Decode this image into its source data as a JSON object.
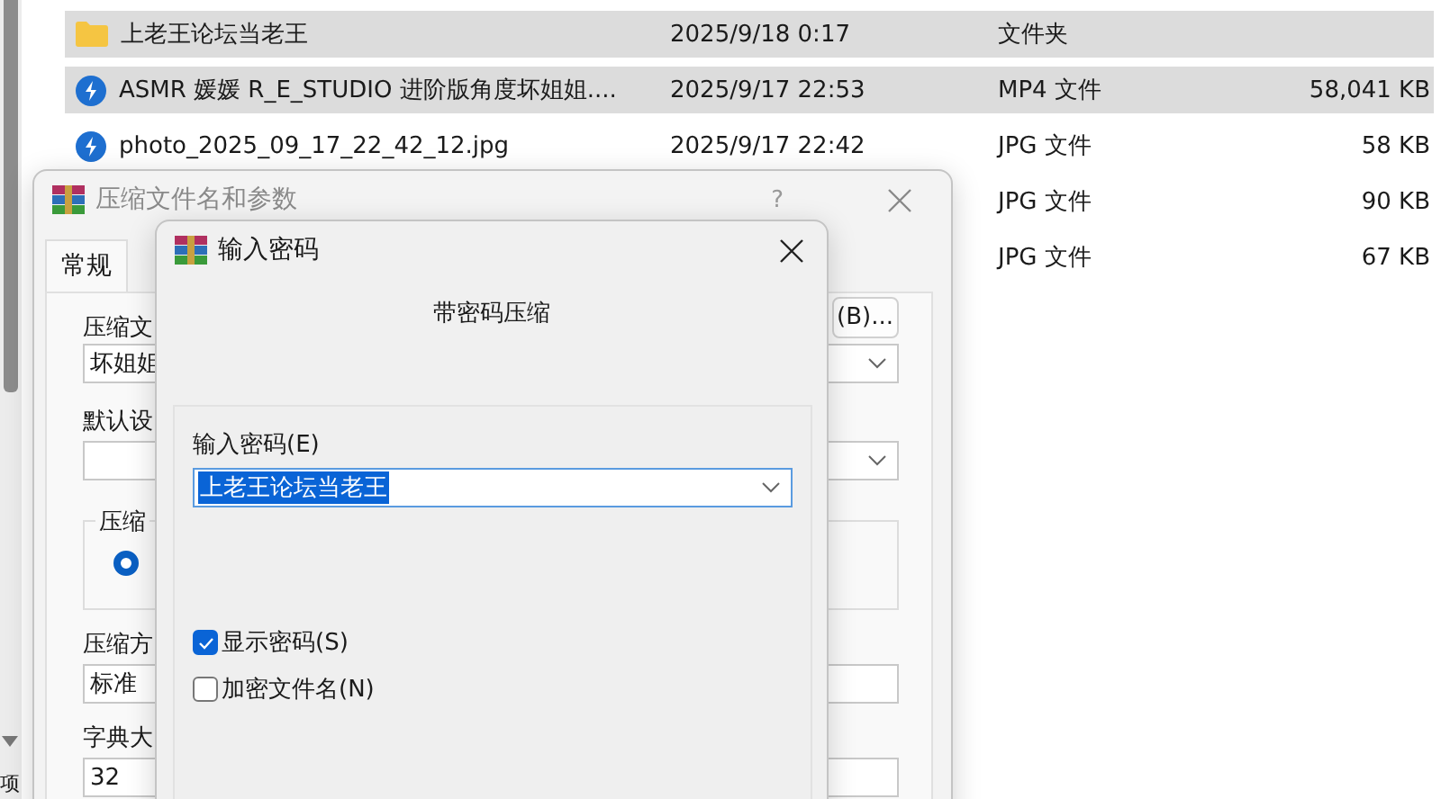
{
  "explorer": {
    "rows": [
      {
        "kind": "folder",
        "name": "上老王论坛当老王",
        "date": "2025/9/18 0:17",
        "type": "文件夹",
        "size": "",
        "selected": true
      },
      {
        "kind": "media",
        "name": "ASMR  媛媛 R_E_STUDIO  进阶版角度坏姐姐....",
        "date": "2025/9/17 22:53",
        "type": "MP4 文件",
        "size": "58,041 KB",
        "selected": true
      },
      {
        "kind": "media",
        "name": "photo_2025_09_17_22_42_12.jpg",
        "date": "2025/9/17 22:42",
        "type": "JPG 文件",
        "size": "58 KB",
        "selected": false
      },
      {
        "kind": "hidden",
        "type": "JPG 文件",
        "size": "90 KB",
        "selected": false
      },
      {
        "kind": "hidden",
        "type": "JPG 文件",
        "size": "67 KB",
        "selected": false
      }
    ]
  },
  "status_bar": {
    "text": "项"
  },
  "compress_dialog": {
    "title": "压缩文件名和参数",
    "help": "?",
    "tabs": [
      {
        "label": "常规",
        "selected": true
      }
    ],
    "archive_name_label": "压缩文",
    "archive_name_value": "坏姐姐",
    "browse_button": "(B)...",
    "profile_label": "默认设",
    "group_label": "压缩",
    "radio": {
      "selected": true
    },
    "method_label": "压缩方",
    "method_value": "标准",
    "dict_label": "字典大",
    "dict_value": "32"
  },
  "password_dialog": {
    "title": "输入密码",
    "heading": "带密码压缩",
    "password_label": "输入密码(E)",
    "password_value": "上老王论坛当老王",
    "value_selected": true,
    "options": [
      {
        "label": "显示密码(S)",
        "checked": true
      },
      {
        "label": "加密文件名(N)",
        "checked": false
      }
    ]
  }
}
